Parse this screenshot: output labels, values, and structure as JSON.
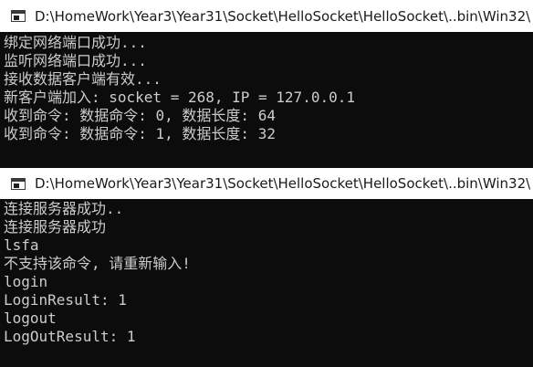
{
  "window1": {
    "title": "D:\\HomeWork\\Year3\\Year31\\Socket\\HelloSocket\\HelloSocket\\..bin\\Win32\\",
    "lines": [
      "绑定网络端口成功...",
      "监听网络端口成功...",
      "接收数据客户端有效...",
      "新客户端加入: socket = 268, IP = 127.0.0.1",
      "收到命令: 数据命令: 0, 数据长度: 64",
      "收到命令: 数据命令: 1, 数据长度: 32"
    ]
  },
  "window2": {
    "title": "D:\\HomeWork\\Year3\\Year31\\Socket\\HelloSocket\\HelloSocket\\..bin\\Win32\\",
    "lines": [
      "连接服务器成功..",
      "连接服务器成功",
      "lsfa",
      "不支持该命令, 请重新输入!",
      "login",
      "LoginResult: 1",
      "logout",
      "LogOutResult: 1"
    ]
  },
  "icons": {
    "window_icon": "console-window-icon"
  }
}
